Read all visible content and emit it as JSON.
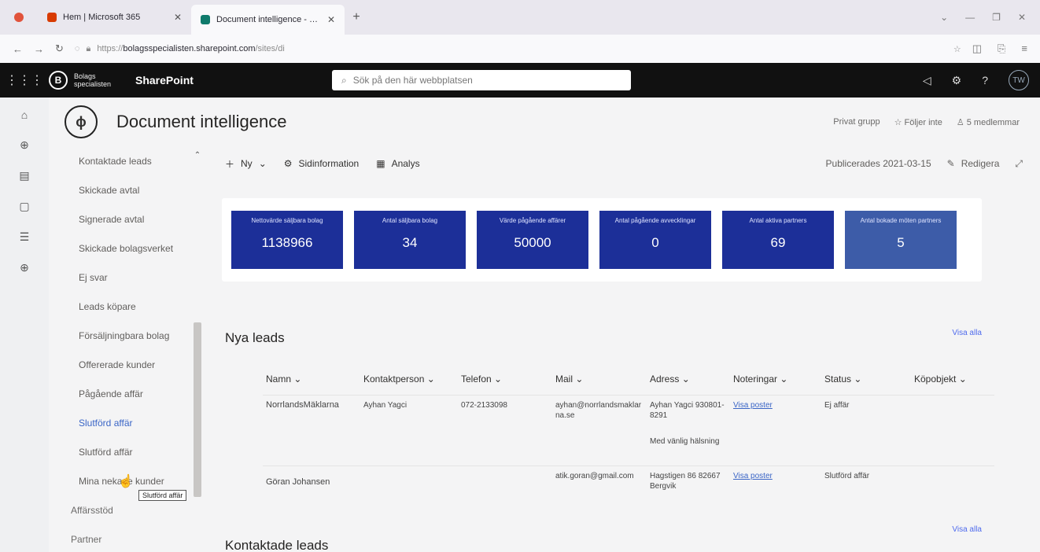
{
  "browser": {
    "tabs": [
      {
        "label": "Hem | Microsoft 365",
        "close": "✕",
        "favicon_color": "#d83b01"
      },
      {
        "label": "Document intelligence - Startsi",
        "close": "✕",
        "favicon_color": "#0f7b6c"
      }
    ],
    "new_tab": "+",
    "url_prefix": "https://",
    "url_host": "bolagsspecialisten.sharepoint.com",
    "url_path": "/sites/di"
  },
  "suite": {
    "logo_text_line1": "Bolags",
    "logo_text_line2": "specialisten",
    "app_name": "SharePoint",
    "search_placeholder": "Sök på den här webbplatsen",
    "avatar": "TW"
  },
  "site": {
    "title": "Document intelligence",
    "group_type": "Privat grupp",
    "follow": "Följer inte",
    "members": "5 medlemmar"
  },
  "nav": {
    "items": [
      {
        "label": "Kontaktade leads"
      },
      {
        "label": "Skickade avtal"
      },
      {
        "label": "Signerade avtal"
      },
      {
        "label": "Skickade bolagsverket"
      },
      {
        "label": "Ej svar"
      },
      {
        "label": "Leads köpare"
      },
      {
        "label": "Försäljningbara bolag"
      },
      {
        "label": "Offererade kunder"
      },
      {
        "label": "Pågående affär"
      },
      {
        "label": "Slutförd affär"
      },
      {
        "label": "Slutförd affär"
      },
      {
        "label": "Mina nekade kunder"
      }
    ],
    "groups": [
      "Affärsstöd",
      "Partner"
    ],
    "tooltip": "Slutförd affär"
  },
  "commandbar": {
    "new": "Ny",
    "page_info": "Sidinformation",
    "analytics": "Analys",
    "published": "Publicerades 2021-03-15",
    "edit": "Redigera"
  },
  "kpis": [
    {
      "label": "Nettovärde säljbara bolag",
      "value": "1138966"
    },
    {
      "label": "Antal säljbara bolag",
      "value": "34"
    },
    {
      "label": "Värde pågående affärer",
      "value": "50000"
    },
    {
      "label": "Antal pågående avvecklingar",
      "value": "0"
    },
    {
      "label": "Antal aktiva partners",
      "value": "69"
    },
    {
      "label": "Antal bokade möten partners",
      "value": "5"
    }
  ],
  "leads": {
    "title": "Nya leads",
    "see_all": "Visa alla",
    "columns": [
      "Namn",
      "Kontaktperson",
      "Telefon",
      "Mail",
      "Adress",
      "Noteringar",
      "Status",
      "Köpobjekt"
    ],
    "rows": [
      {
        "name": "NorrlandsMäklarna",
        "contact": "Ayhan Yagci",
        "phone": "072-2133098",
        "mail": "ayhan@norrlandsmaklarna.se",
        "address": "Ayhan Yagci 930801-8291",
        "address_extra": "Med vänlig hälsning",
        "notes": "Visa poster",
        "status": "Ej affär",
        "object": ""
      },
      {
        "name": "Göran Johansen",
        "contact": "",
        "phone": "",
        "mail": "atik.goran@gmail.com",
        "address": "Hagstigen 86 82667 Bergvik",
        "address_extra": "",
        "notes": "Visa poster",
        "status": "Slutförd affär",
        "object": ""
      }
    ]
  },
  "contacted": {
    "title": "Kontaktade leads",
    "see_all": "Visa alla"
  }
}
